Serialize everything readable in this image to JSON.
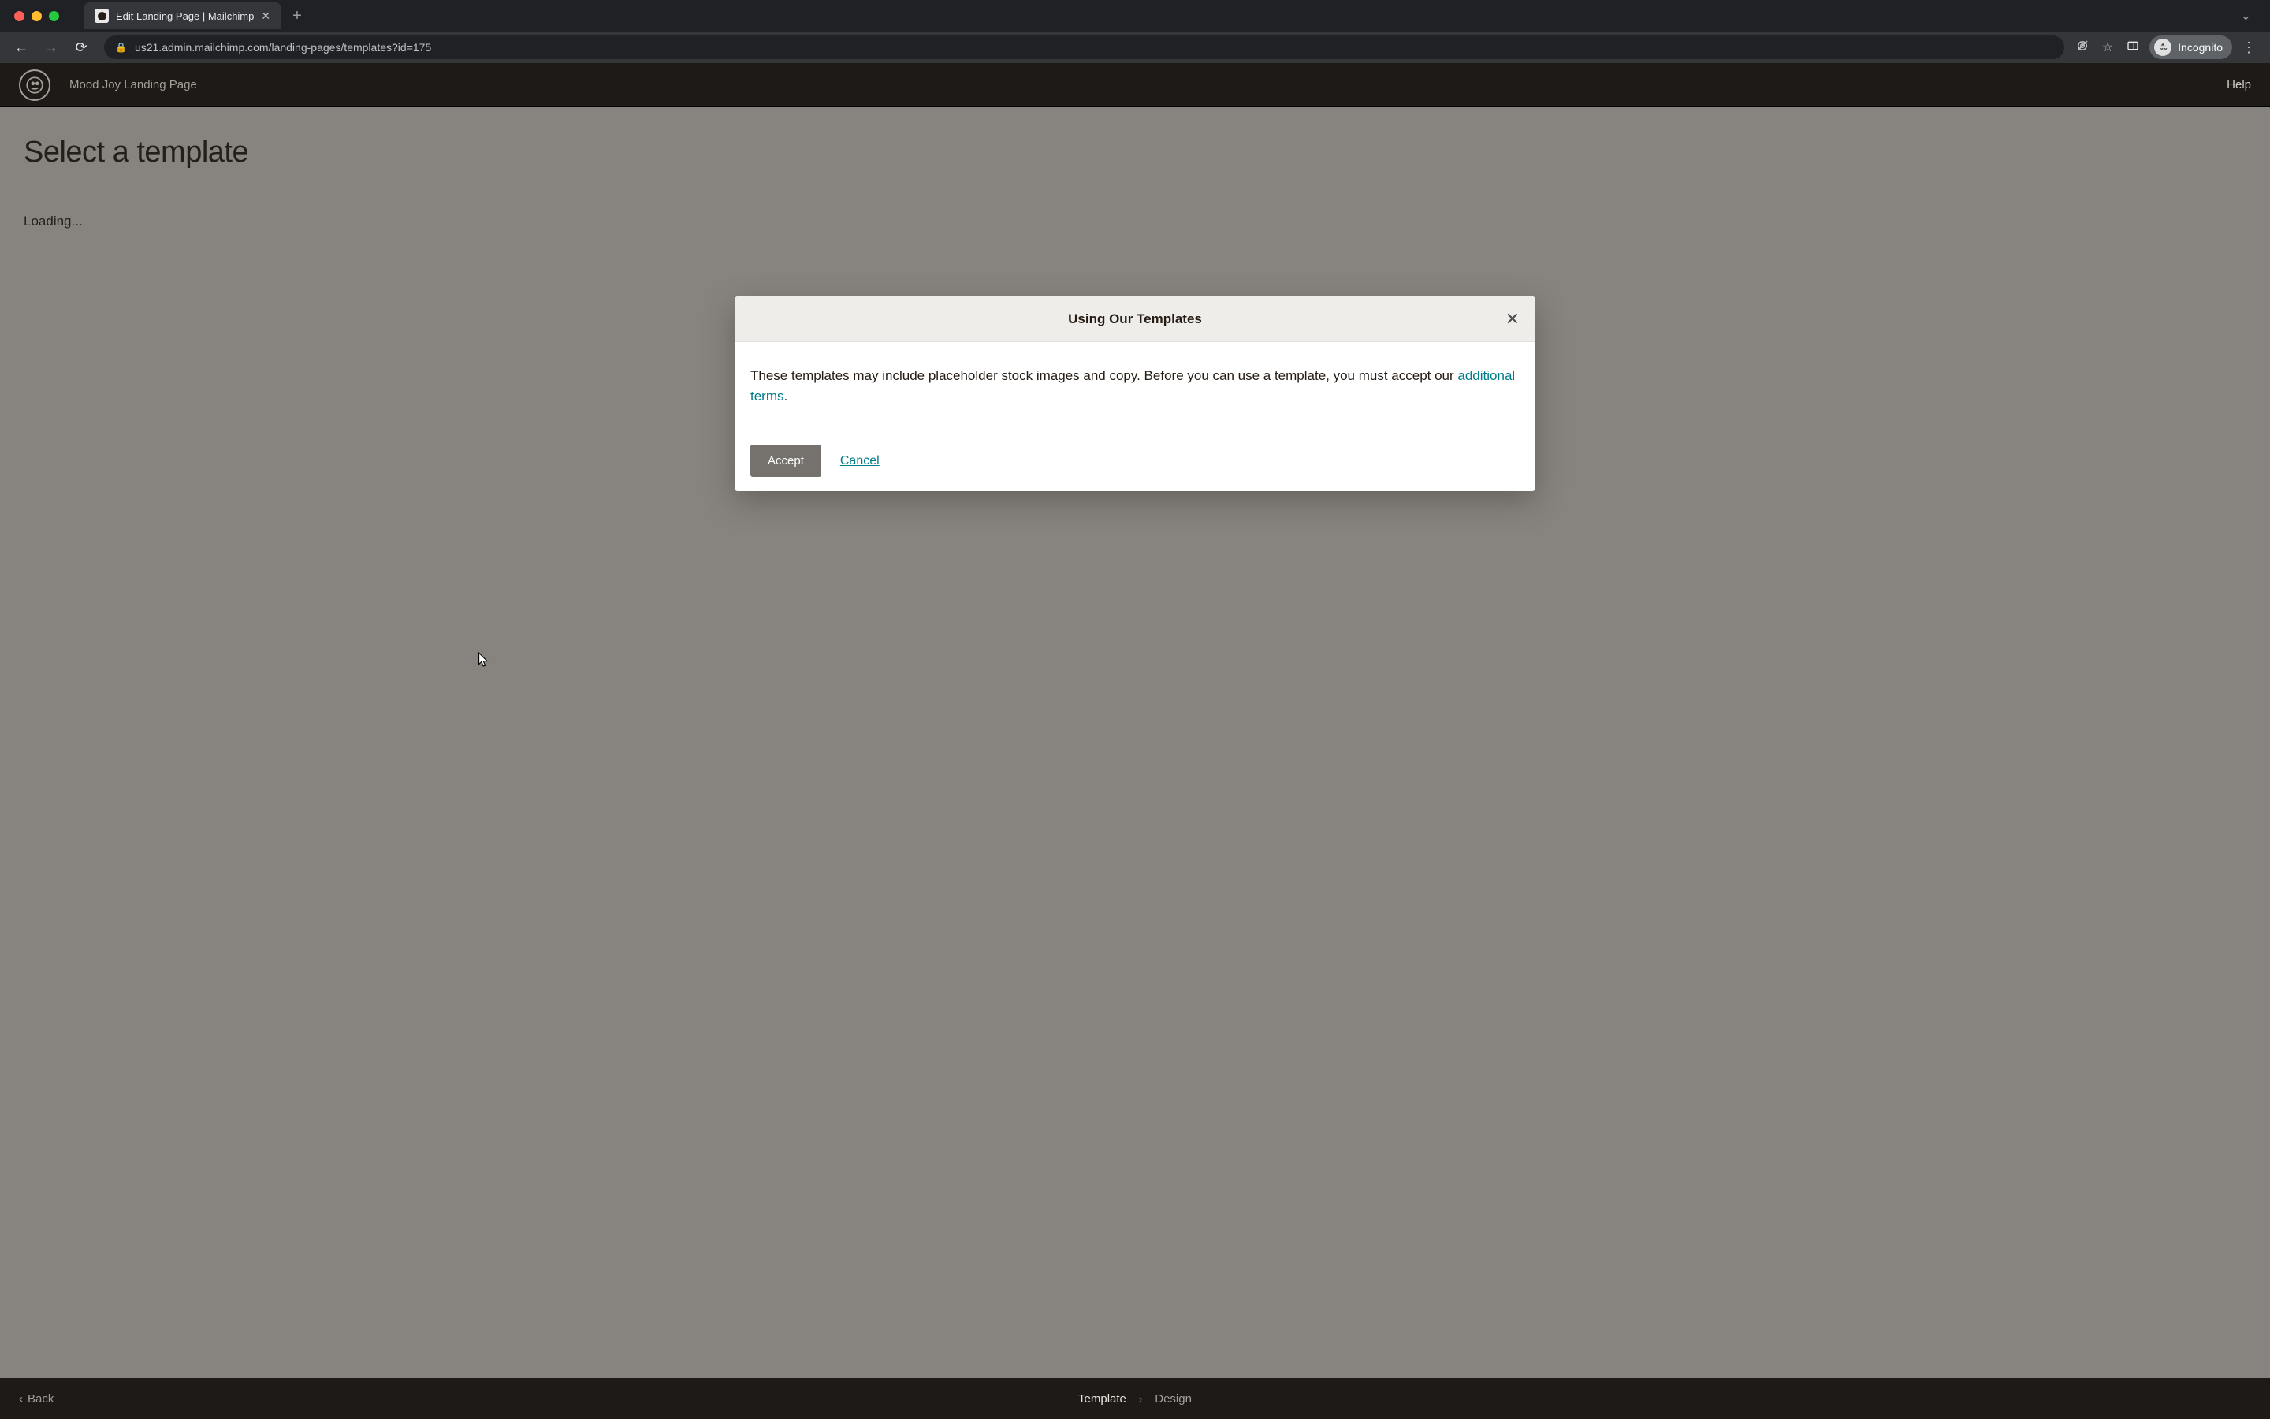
{
  "browser": {
    "tab_title": "Edit Landing Page | Mailchimp",
    "url": "us21.admin.mailchimp.com/landing-pages/templates?id=175",
    "incognito_label": "Incognito"
  },
  "mc_header": {
    "page_name": "Mood Joy Landing Page",
    "help_label": "Help"
  },
  "page": {
    "title": "Select a template",
    "loading_text": "Loading..."
  },
  "modal": {
    "title": "Using Our Templates",
    "body_prefix": "These templates may include placeholder stock images and copy. Before you can use a template, you must accept our ",
    "link_text": "additional terms",
    "body_suffix": ".",
    "accept_label": "Accept",
    "cancel_label": "Cancel"
  },
  "footer": {
    "back_label": "Back",
    "step_current": "Template",
    "step_next": "Design"
  }
}
